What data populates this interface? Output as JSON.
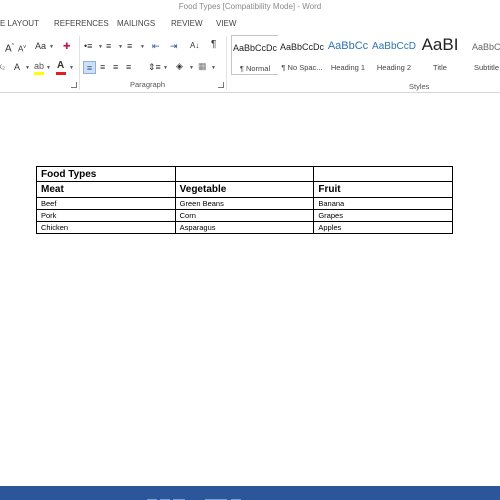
{
  "window": {
    "title": "Food Types [Compatibility Mode] - Word"
  },
  "tabs": [
    "E LAYOUT",
    "REFERENCES",
    "MAILINGS",
    "REVIEW",
    "VIEW"
  ],
  "ribbon": {
    "font_group": {
      "font_size_up": "A",
      "font_size_down": "A",
      "change_case": "Aa",
      "clear_format": "✚",
      "highlight_color": "#ffff00",
      "font_color": "#e02020"
    },
    "paragraph_group": {
      "label": "Paragraph",
      "show_marks": "¶"
    },
    "styles_group": {
      "label": "Styles",
      "styles": [
        {
          "sample": "AaBbCcDc",
          "name": "¶ Normal",
          "selected": true
        },
        {
          "sample": "AaBbCcDc",
          "name": "¶ No Spac..."
        },
        {
          "sample": "AaBbCc",
          "name": "Heading 1"
        },
        {
          "sample": "AaBbCcD",
          "name": "Heading 2"
        },
        {
          "sample": "AaBI",
          "name": "Title"
        },
        {
          "sample": "AaBbCcC",
          "name": "Subtitle"
        }
      ]
    }
  },
  "document": {
    "table": {
      "caption": "Food Types",
      "headers": [
        "Meat",
        "Vegetable",
        "Fruit"
      ],
      "rows": [
        [
          "Beef",
          "Green Beans",
          "Banana"
        ],
        [
          "Pork",
          "Corn",
          "Grapes"
        ],
        [
          "Chicken",
          "Asparagus",
          "Apples"
        ]
      ]
    }
  },
  "colors": {
    "accent": "#2b579a",
    "status_bar": "#2b579a",
    "heading_blue": "#2e74b5"
  }
}
